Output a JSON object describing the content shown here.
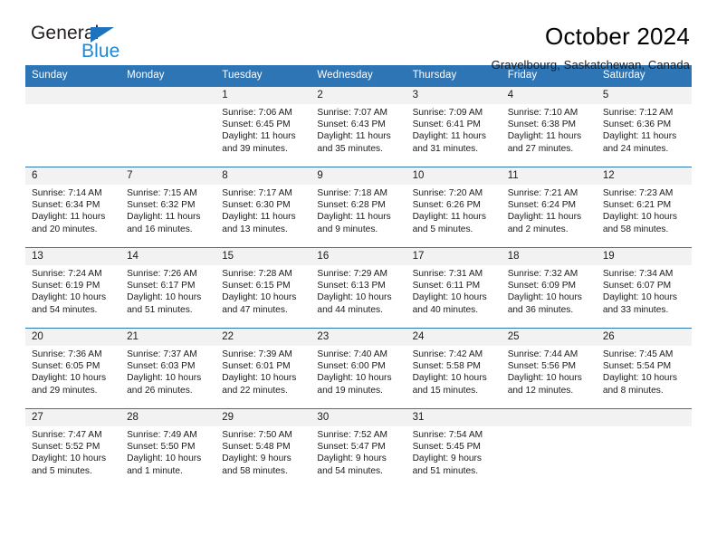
{
  "brand": {
    "name_part1": "General",
    "name_part2": "Blue",
    "colors": {
      "general": "#231f20",
      "blue": "#1e87d4",
      "triangle": "#1e73be"
    }
  },
  "header": {
    "title": "October 2024",
    "subtitle": "Gravelbourg, Saskatchewan, Canada"
  },
  "theme": {
    "header_row_bg": "#2e75b6",
    "daynum_bg": "#f2f2f2",
    "cell_border": "#2e75b6"
  },
  "weekdays": [
    "Sunday",
    "Monday",
    "Tuesday",
    "Wednesday",
    "Thursday",
    "Friday",
    "Saturday"
  ],
  "weeks": [
    [
      {
        "day": ""
      },
      {
        "day": ""
      },
      {
        "day": "1",
        "sunrise": "Sunrise: 7:06 AM",
        "sunset": "Sunset: 6:45 PM",
        "daylight": "Daylight: 11 hours and 39 minutes."
      },
      {
        "day": "2",
        "sunrise": "Sunrise: 7:07 AM",
        "sunset": "Sunset: 6:43 PM",
        "daylight": "Daylight: 11 hours and 35 minutes."
      },
      {
        "day": "3",
        "sunrise": "Sunrise: 7:09 AM",
        "sunset": "Sunset: 6:41 PM",
        "daylight": "Daylight: 11 hours and 31 minutes."
      },
      {
        "day": "4",
        "sunrise": "Sunrise: 7:10 AM",
        "sunset": "Sunset: 6:38 PM",
        "daylight": "Daylight: 11 hours and 27 minutes."
      },
      {
        "day": "5",
        "sunrise": "Sunrise: 7:12 AM",
        "sunset": "Sunset: 6:36 PM",
        "daylight": "Daylight: 11 hours and 24 minutes."
      }
    ],
    [
      {
        "day": "6",
        "sunrise": "Sunrise: 7:14 AM",
        "sunset": "Sunset: 6:34 PM",
        "daylight": "Daylight: 11 hours and 20 minutes."
      },
      {
        "day": "7",
        "sunrise": "Sunrise: 7:15 AM",
        "sunset": "Sunset: 6:32 PM",
        "daylight": "Daylight: 11 hours and 16 minutes."
      },
      {
        "day": "8",
        "sunrise": "Sunrise: 7:17 AM",
        "sunset": "Sunset: 6:30 PM",
        "daylight": "Daylight: 11 hours and 13 minutes."
      },
      {
        "day": "9",
        "sunrise": "Sunrise: 7:18 AM",
        "sunset": "Sunset: 6:28 PM",
        "daylight": "Daylight: 11 hours and 9 minutes."
      },
      {
        "day": "10",
        "sunrise": "Sunrise: 7:20 AM",
        "sunset": "Sunset: 6:26 PM",
        "daylight": "Daylight: 11 hours and 5 minutes."
      },
      {
        "day": "11",
        "sunrise": "Sunrise: 7:21 AM",
        "sunset": "Sunset: 6:24 PM",
        "daylight": "Daylight: 11 hours and 2 minutes."
      },
      {
        "day": "12",
        "sunrise": "Sunrise: 7:23 AM",
        "sunset": "Sunset: 6:21 PM",
        "daylight": "Daylight: 10 hours and 58 minutes."
      }
    ],
    [
      {
        "day": "13",
        "sunrise": "Sunrise: 7:24 AM",
        "sunset": "Sunset: 6:19 PM",
        "daylight": "Daylight: 10 hours and 54 minutes."
      },
      {
        "day": "14",
        "sunrise": "Sunrise: 7:26 AM",
        "sunset": "Sunset: 6:17 PM",
        "daylight": "Daylight: 10 hours and 51 minutes."
      },
      {
        "day": "15",
        "sunrise": "Sunrise: 7:28 AM",
        "sunset": "Sunset: 6:15 PM",
        "daylight": "Daylight: 10 hours and 47 minutes."
      },
      {
        "day": "16",
        "sunrise": "Sunrise: 7:29 AM",
        "sunset": "Sunset: 6:13 PM",
        "daylight": "Daylight: 10 hours and 44 minutes."
      },
      {
        "day": "17",
        "sunrise": "Sunrise: 7:31 AM",
        "sunset": "Sunset: 6:11 PM",
        "daylight": "Daylight: 10 hours and 40 minutes."
      },
      {
        "day": "18",
        "sunrise": "Sunrise: 7:32 AM",
        "sunset": "Sunset: 6:09 PM",
        "daylight": "Daylight: 10 hours and 36 minutes."
      },
      {
        "day": "19",
        "sunrise": "Sunrise: 7:34 AM",
        "sunset": "Sunset: 6:07 PM",
        "daylight": "Daylight: 10 hours and 33 minutes."
      }
    ],
    [
      {
        "day": "20",
        "sunrise": "Sunrise: 7:36 AM",
        "sunset": "Sunset: 6:05 PM",
        "daylight": "Daylight: 10 hours and 29 minutes."
      },
      {
        "day": "21",
        "sunrise": "Sunrise: 7:37 AM",
        "sunset": "Sunset: 6:03 PM",
        "daylight": "Daylight: 10 hours and 26 minutes."
      },
      {
        "day": "22",
        "sunrise": "Sunrise: 7:39 AM",
        "sunset": "Sunset: 6:01 PM",
        "daylight": "Daylight: 10 hours and 22 minutes."
      },
      {
        "day": "23",
        "sunrise": "Sunrise: 7:40 AM",
        "sunset": "Sunset: 6:00 PM",
        "daylight": "Daylight: 10 hours and 19 minutes."
      },
      {
        "day": "24",
        "sunrise": "Sunrise: 7:42 AM",
        "sunset": "Sunset: 5:58 PM",
        "daylight": "Daylight: 10 hours and 15 minutes."
      },
      {
        "day": "25",
        "sunrise": "Sunrise: 7:44 AM",
        "sunset": "Sunset: 5:56 PM",
        "daylight": "Daylight: 10 hours and 12 minutes."
      },
      {
        "day": "26",
        "sunrise": "Sunrise: 7:45 AM",
        "sunset": "Sunset: 5:54 PM",
        "daylight": "Daylight: 10 hours and 8 minutes."
      }
    ],
    [
      {
        "day": "27",
        "sunrise": "Sunrise: 7:47 AM",
        "sunset": "Sunset: 5:52 PM",
        "daylight": "Daylight: 10 hours and 5 minutes."
      },
      {
        "day": "28",
        "sunrise": "Sunrise: 7:49 AM",
        "sunset": "Sunset: 5:50 PM",
        "daylight": "Daylight: 10 hours and 1 minute."
      },
      {
        "day": "29",
        "sunrise": "Sunrise: 7:50 AM",
        "sunset": "Sunset: 5:48 PM",
        "daylight": "Daylight: 9 hours and 58 minutes."
      },
      {
        "day": "30",
        "sunrise": "Sunrise: 7:52 AM",
        "sunset": "Sunset: 5:47 PM",
        "daylight": "Daylight: 9 hours and 54 minutes."
      },
      {
        "day": "31",
        "sunrise": "Sunrise: 7:54 AM",
        "sunset": "Sunset: 5:45 PM",
        "daylight": "Daylight: 9 hours and 51 minutes."
      },
      {
        "day": ""
      },
      {
        "day": ""
      }
    ]
  ]
}
